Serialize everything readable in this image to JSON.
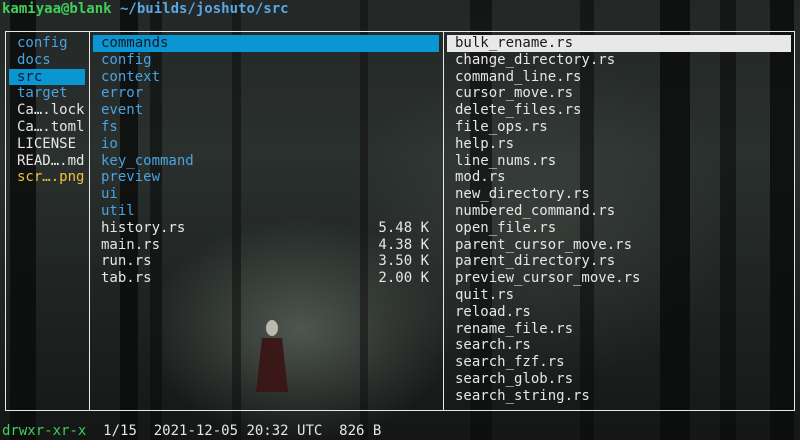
{
  "title": {
    "host": "kamiyaa@blank",
    "path": " ~/builds/joshuto/src"
  },
  "parent_column": {
    "items": [
      {
        "label": "config",
        "kind": "dir"
      },
      {
        "label": "docs",
        "kind": "dir"
      },
      {
        "label": "src",
        "kind": "dir",
        "selected": true
      },
      {
        "label": "target",
        "kind": "dir"
      },
      {
        "label": "Ca….lock",
        "kind": "file"
      },
      {
        "label": "Ca….toml",
        "kind": "file"
      },
      {
        "label": "LICENSE",
        "kind": "file"
      },
      {
        "label": "READ….md",
        "kind": "file"
      },
      {
        "label": "scr….png",
        "kind": "image"
      }
    ]
  },
  "current_column": {
    "items": [
      {
        "label": "commands",
        "kind": "dir",
        "selected": true,
        "size": ""
      },
      {
        "label": "config",
        "kind": "dir",
        "size": ""
      },
      {
        "label": "context",
        "kind": "dir",
        "size": ""
      },
      {
        "label": "error",
        "kind": "dir",
        "size": ""
      },
      {
        "label": "event",
        "kind": "dir",
        "size": ""
      },
      {
        "label": "fs",
        "kind": "dir",
        "size": ""
      },
      {
        "label": "io",
        "kind": "dir",
        "size": ""
      },
      {
        "label": "key_command",
        "kind": "dir",
        "size": ""
      },
      {
        "label": "preview",
        "kind": "dir",
        "size": ""
      },
      {
        "label": "ui",
        "kind": "dir",
        "size": ""
      },
      {
        "label": "util",
        "kind": "dir",
        "size": ""
      },
      {
        "label": "history.rs",
        "kind": "file",
        "size": "5.48 K"
      },
      {
        "label": "main.rs",
        "kind": "file",
        "size": "4.38 K"
      },
      {
        "label": "run.rs",
        "kind": "file",
        "size": "3.50 K"
      },
      {
        "label": "tab.rs",
        "kind": "file",
        "size": "2.00 K"
      }
    ]
  },
  "preview_column": {
    "items": [
      {
        "label": "bulk_rename.rs",
        "selected": true
      },
      {
        "label": "change_directory.rs"
      },
      {
        "label": "command_line.rs"
      },
      {
        "label": "cursor_move.rs"
      },
      {
        "label": "delete_files.rs"
      },
      {
        "label": "file_ops.rs"
      },
      {
        "label": "help.rs"
      },
      {
        "label": "line_nums.rs"
      },
      {
        "label": "mod.rs"
      },
      {
        "label": "new_directory.rs"
      },
      {
        "label": "numbered_command.rs"
      },
      {
        "label": "open_file.rs"
      },
      {
        "label": "parent_cursor_move.rs"
      },
      {
        "label": "parent_directory.rs"
      },
      {
        "label": "preview_cursor_move.rs"
      },
      {
        "label": "quit.rs"
      },
      {
        "label": "reload.rs"
      },
      {
        "label": "rename_file.rs"
      },
      {
        "label": "search.rs"
      },
      {
        "label": "search_fzf.rs"
      },
      {
        "label": "search_glob.rs"
      },
      {
        "label": "search_string.rs"
      }
    ]
  },
  "status": {
    "permissions": "drwxr-xr-x",
    "position": "1/15",
    "datetime": "2021-12-05 20:32 UTC",
    "size": "826 B"
  },
  "colors": {
    "directory": "#4aa3e0",
    "selection": "#0a96d2",
    "image_file": "#f0c23b",
    "prompt_green": "#3fcf5a"
  }
}
